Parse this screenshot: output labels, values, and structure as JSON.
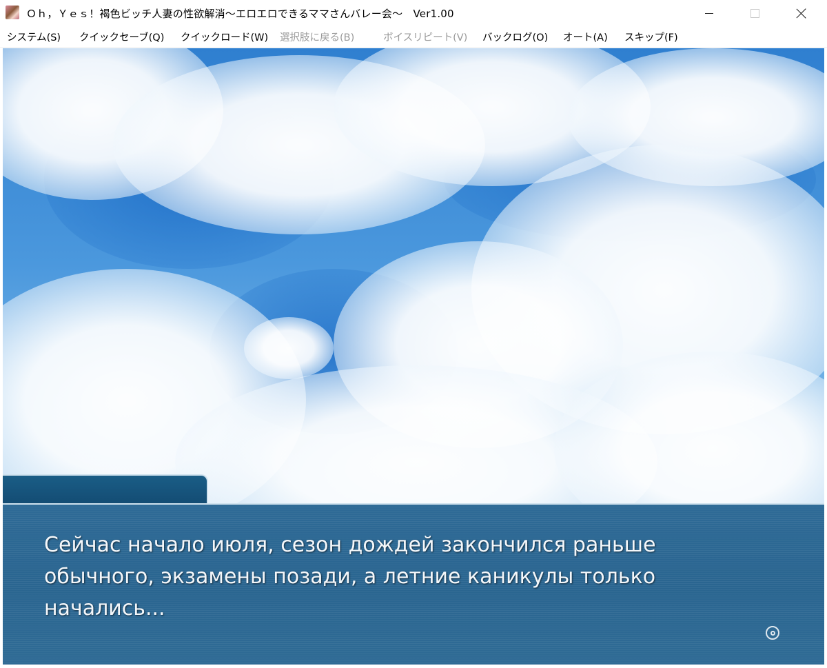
{
  "window": {
    "title": "Ｏｈ，Ｙｅｓ！褐色ビッチ人妻の性欲解消～エロエロできるママさんバレー会～　Ver1.00",
    "icon": "app-icon"
  },
  "menu": {
    "items": [
      {
        "label": "システム(S)",
        "enabled": true
      },
      {
        "label": "クイックセーブ(Q)",
        "enabled": true
      },
      {
        "label": "クイックロード(W)",
        "enabled": true
      },
      {
        "label": "選択肢に戻る(B)",
        "enabled": false
      },
      {
        "label": "ボイスリピート(V)",
        "enabled": false
      },
      {
        "label": "バックログ(O)",
        "enabled": true
      },
      {
        "label": "オート(A)",
        "enabled": true
      },
      {
        "label": "スキップ(F)",
        "enabled": true
      }
    ]
  },
  "message": {
    "speaker": "",
    "lines": [
      "Сейчас начало июля, сезон дождей закончился раньше",
      "обычного, экзамены позади, а летние каникулы только",
      "начались..."
    ]
  },
  "colors": {
    "textbox": "#2e6a96",
    "name_tab": "#134b72",
    "sky": "#4b98dd"
  }
}
